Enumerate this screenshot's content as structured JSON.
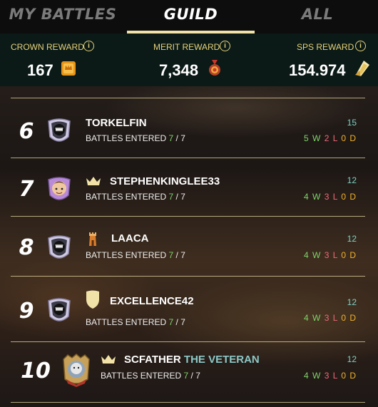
{
  "tabs": [
    {
      "label": "MY BATTLES"
    },
    {
      "label": "GUILD"
    },
    {
      "label": "ALL"
    }
  ],
  "rewards": {
    "crown": {
      "label": "CROWN REWARD",
      "value": "167",
      "icon": "crown-token-icon"
    },
    "merit": {
      "label": "MERIT REWARD",
      "value": "7,348",
      "icon": "merit-medal-icon"
    },
    "sps": {
      "label": "SPS REWARD",
      "value": "154.974",
      "icon": "sps-token-icon"
    },
    "info_glyph": "i"
  },
  "battles_label": "BATTLES ENTERED",
  "slash": "/",
  "players": [
    {
      "rank": "6",
      "name": "TORKELFIN",
      "title": "",
      "entered": "7",
      "total": "7",
      "score": "15",
      "w": "5 W",
      "l": "2 L",
      "d": "0 D",
      "badge": "none"
    },
    {
      "rank": "7",
      "name": "STEPHENKINGLEE33",
      "title": "",
      "entered": "7",
      "total": "7",
      "score": "12",
      "w": "4 W",
      "l": "3 L",
      "d": "0 D",
      "badge": "crown-icon"
    },
    {
      "rank": "8",
      "name": "LAACA",
      "title": "",
      "entered": "7",
      "total": "7",
      "score": "12",
      "w": "4 W",
      "l": "3 L",
      "d": "0 D",
      "badge": "tower-icon"
    },
    {
      "rank": "9",
      "name": "EXCELLENCE42",
      "title": "",
      "entered": "7",
      "total": "7",
      "score": "12",
      "w": "4 W",
      "l": "3 L",
      "d": "0 D",
      "badge": "shield-icon"
    },
    {
      "rank": "10",
      "name": "SCFATHER",
      "title": "THE VETERAN",
      "entered": "7",
      "total": "7",
      "score": "12",
      "w": "4 W",
      "l": "3 L",
      "d": "0 D",
      "badge": "crown-icon"
    }
  ],
  "colors": {
    "accent": "#f1e2a8",
    "win": "#7ed46b",
    "loss": "#ec6a78",
    "draw": "#f2b22a",
    "score": "#7fd1c4"
  }
}
